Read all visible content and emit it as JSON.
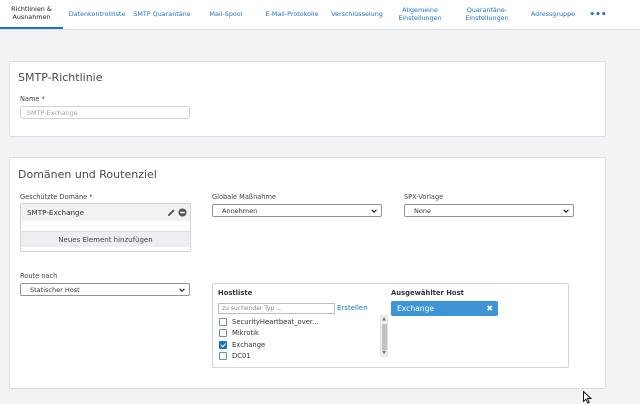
{
  "tabs": [
    {
      "label": "Richtlinien &\nAusnahmen",
      "active": true
    },
    {
      "label": "Datenkontrollliste"
    },
    {
      "label": "SMTP Quarantäne"
    },
    {
      "label": "Mail-Spool"
    },
    {
      "label": "E-Mail-Protokolle"
    },
    {
      "label": "Verschlüsselung"
    },
    {
      "label": "Allgemeine\nEinstellungen"
    },
    {
      "label": "Quarantäne-\nEinstellungen"
    },
    {
      "label": "Adressgruppe"
    },
    {
      "label": "•••"
    }
  ],
  "policy_panel": {
    "title": "SMTP-Richtlinie",
    "name_label": "Name *",
    "name_placeholder": "SMTP-Exchange"
  },
  "domains_panel": {
    "title": "Domänen und Routenziel",
    "protected_domain_label": "Geschützte Domäne *",
    "protected_domain_value": "SMTP-Exchange",
    "add_item_label": "Neues Element hinzufügen",
    "global_action_label": "Globale Maßnahme",
    "global_action_value": "Annehmen",
    "spx_label": "SPX-Vorlage",
    "spx_value": "None",
    "route_label": "Route nach",
    "route_value": "Statischer Host"
  },
  "host_picker": {
    "list_title": "Hostliste",
    "search_placeholder": "zu suchender Typ ...",
    "create_link": "Erstellen",
    "items": [
      {
        "label": "SecurityHeartbeat_over...",
        "checked": false
      },
      {
        "label": "Mikrotik",
        "checked": false
      },
      {
        "label": "Exchange",
        "checked": true
      },
      {
        "label": "DC01",
        "checked": false
      }
    ],
    "selected_title": "Ausgewählter Host",
    "selected_value": "Exchange"
  },
  "colors": {
    "accent": "#1b73c9",
    "chip": "#3d94d6"
  }
}
